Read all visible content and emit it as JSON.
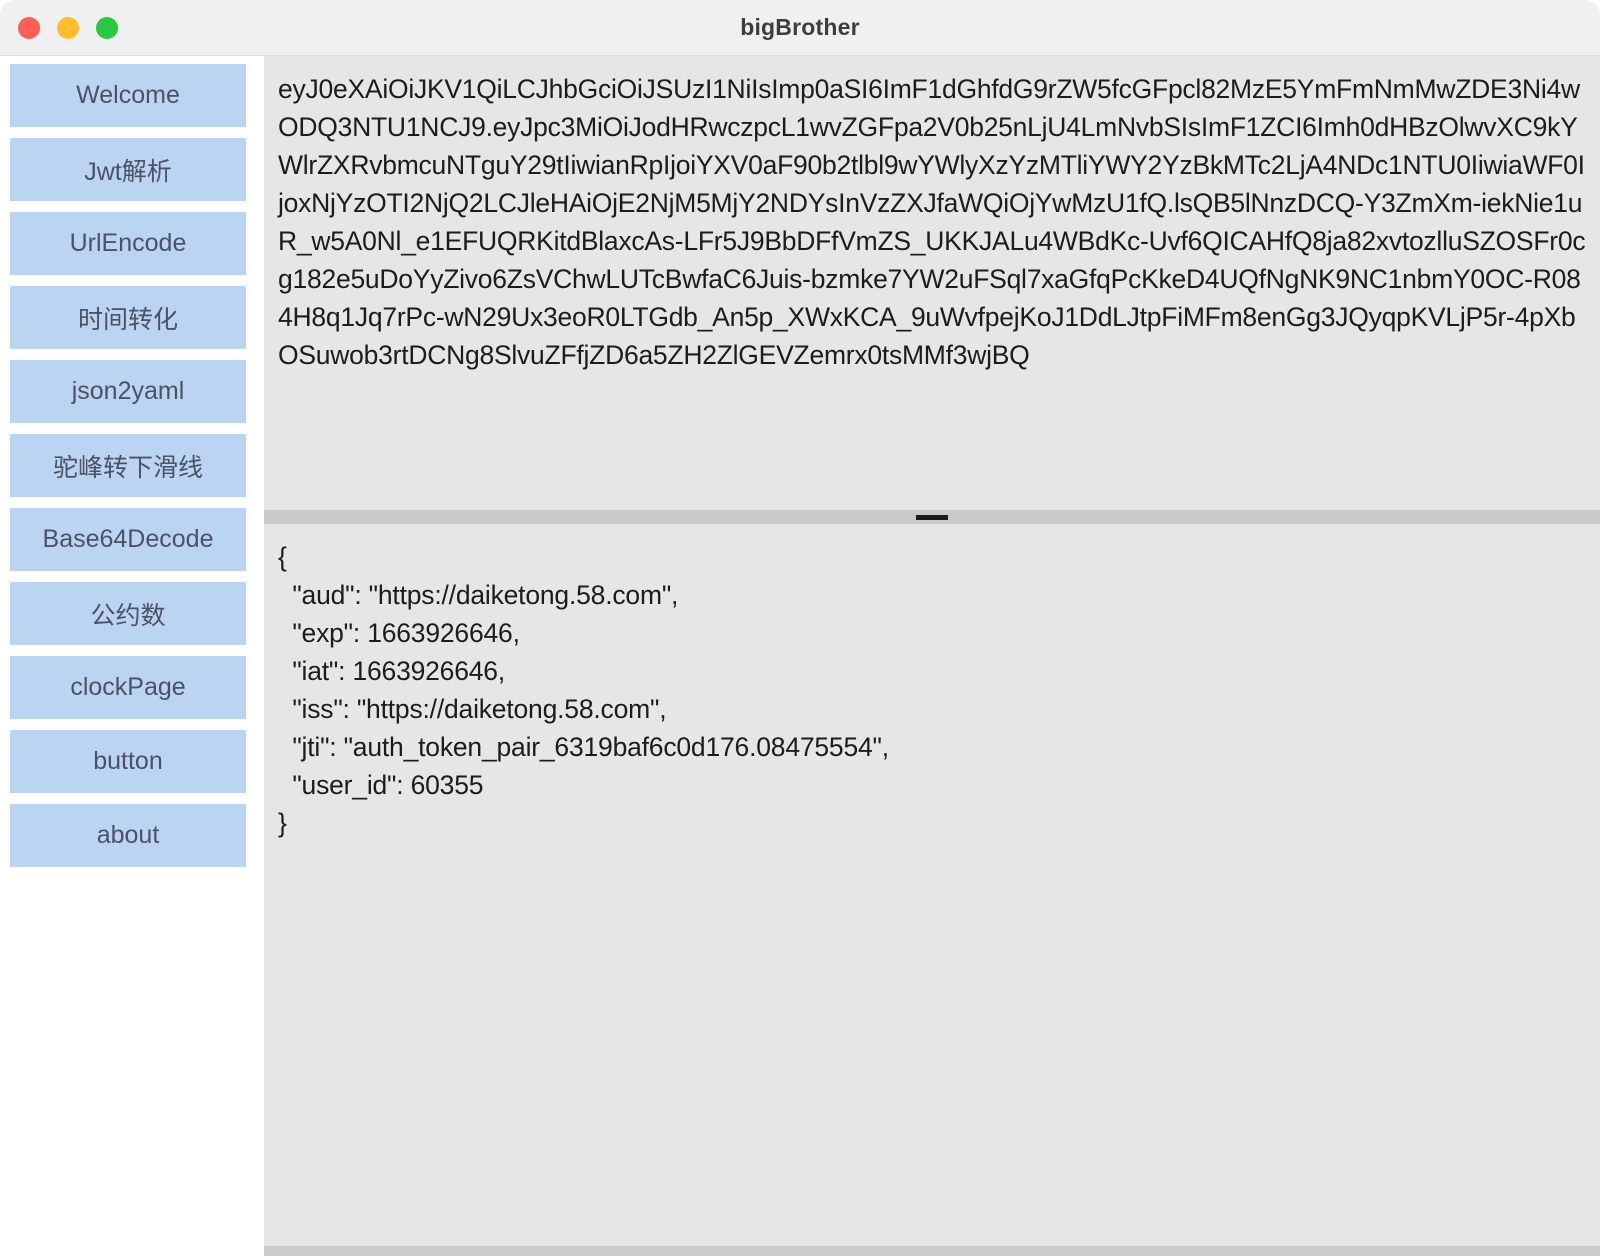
{
  "window": {
    "title": "bigBrother",
    "controls": [
      {
        "name": "close",
        "color": "#ff5f57"
      },
      {
        "name": "minimize",
        "color": "#febc2e"
      },
      {
        "name": "maximize",
        "color": "#28c840"
      }
    ]
  },
  "theme": {
    "nav_item_bg": "#bbd4f2",
    "nav_item_text": "#4c5265",
    "pane_bg": "#e6e6e6",
    "splitter_bg": "#cacaca",
    "titlebar_bg": "#f0f0f0"
  },
  "sidebar": {
    "items": [
      {
        "label": "Welcome",
        "name": "welcome"
      },
      {
        "label": "Jwt解析",
        "name": "jwt-parse"
      },
      {
        "label": "UrlEncode",
        "name": "url-encode"
      },
      {
        "label": "时间转化",
        "name": "time-convert"
      },
      {
        "label": "json2yaml",
        "name": "json2yaml"
      },
      {
        "label": "驼峰转下滑线",
        "name": "camel-to-underscore"
      },
      {
        "label": "Base64Decode",
        "name": "base64-decode"
      },
      {
        "label": "公约数",
        "name": "common-divisor"
      },
      {
        "label": "clockPage",
        "name": "clock-page"
      },
      {
        "label": "button",
        "name": "button"
      },
      {
        "label": "about",
        "name": "about"
      }
    ]
  },
  "main": {
    "token_input": {
      "value": "eyJ0eXAiOiJKV1QiLCJhbGciOiJSUzI1NiIsImp0aSI6ImF1dGhfdG9rZW5fcGFpcl82MzE5YmFmNmMwZDE3Ni4wODQ3NTU1NCJ9.eyJpc3MiOiJodHRwczpcL1wvZGFpa2V0b25nLjU4LmNvbSIsImF1ZCI6Imh0dHBzOlwvXC9kYWlrZXRvbmcuNTguY29tIiwianRpIjoiYXV0aF90b2tlbl9wYWlyXzYzMTliYWY2YzBkMTc2LjA4NDc1NTU0IiwiaWF0IjoxNjYzOTI2NjQ2LCJleHAiOjE2NjM5MjY2NDYsInVzZXJfaWQiOjYwMzU1fQ.lsQB5lNnzDCQ-Y3ZmXm-iekNie1uR_w5A0Nl_e1EFUQRKitdBlaxcAs-LFr5J9BbDFfVmZS_UKKJALu4WBdKc-Uvf6QICAHfQ8ja82xvtozlluSZOSFr0cg182e5uDoYyZivo6ZsVChwLUTcBwfaC6Juis-bzmke7YW2uFSql7xaGfqPcKkeD4UQfNgNK9NC1nbmY0OC-R084H8q1Jq7rPc-wN29Ux3eoR0LTGdb_An5p_XWxKCA_9uWvfpejKoJ1DdLJtpFiMFm8enGg3JQyqpKVLjP5r-4pXbOSuwob3rtDCNg8SlvuZFfjZD6a5ZH2ZlGEVZemrx0tsMMf3wjBQ"
    },
    "result_output": {
      "value": "{\n  \"aud\": \"https://daiketong.58.com\",\n  \"exp\": 1663926646,\n  \"iat\": 1663926646,\n  \"iss\": \"https://daiketong.58.com\",\n  \"jti\": \"auth_token_pair_6319baf6c0d176.08475554\",\n  \"user_id\": 60355\n}"
    },
    "splitter": {
      "handle": "drag-handle"
    }
  }
}
